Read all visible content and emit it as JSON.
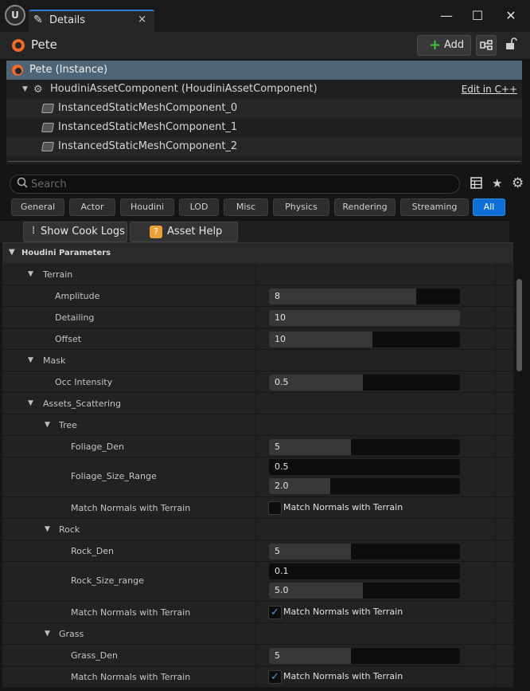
{
  "window": {
    "tab_title": "Details",
    "tab_close": "×",
    "minimize": "—",
    "maximize": "☐",
    "close": "✕"
  },
  "actor": {
    "name": "Pete",
    "add_label": "Add"
  },
  "tree": {
    "root": "Pete (Instance)",
    "component": "HoudiniAssetComponent (HoudiniAssetComponent)",
    "edit_link": "Edit in C++",
    "children": [
      "InstancedStaticMeshComponent_0",
      "InstancedStaticMeshComponent_1",
      "InstancedStaticMeshComponent_2"
    ]
  },
  "search": {
    "placeholder": "Search"
  },
  "categories": [
    "General",
    "Actor",
    "Houdini",
    "LOD",
    "Misc",
    "Physics",
    "Rendering",
    "Streaming",
    "All"
  ],
  "active_category": "All",
  "toolbar": {
    "cook_logs": "Show Cook Logs",
    "asset_help": "Asset Help"
  },
  "section": {
    "title": "Houdini Parameters"
  },
  "params": {
    "terrain": "Terrain",
    "amplitude_label": "Amplitude",
    "amplitude": "8",
    "amplitude_level": 0.77,
    "detailing_label": "Detailing",
    "detailing": "10",
    "detailing_level": 1.0,
    "offset_label": "Offset",
    "offset": "10",
    "offset_level": 0.54,
    "mask": "Mask",
    "occ_label": "Occ Intensity",
    "occ": "0.5",
    "occ_level": 0.49,
    "assets": "Assets_Scattering",
    "tree": "Tree",
    "foliage_den_label": "Foliage_Den",
    "foliage_den": "5",
    "foliage_den_level": 0.43,
    "foliage_size_label": "Foliage_Size_Range",
    "foliage_size_min": "0.5",
    "foliage_size_min_level": 0.0,
    "foliage_size_max": "2.0",
    "foliage_size_max_level": 0.32,
    "tree_match_label": "Match Normals with Terrain",
    "tree_match_check": "Match Normals with Terrain",
    "tree_match": false,
    "rock": "Rock",
    "rock_den_label": "Rock_Den",
    "rock_den": "5",
    "rock_den_level": 0.43,
    "rock_size_label": "Rock_Size_range",
    "rock_size_min": "0.1",
    "rock_size_min_level": 0.0,
    "rock_size_max": "5.0",
    "rock_size_max_level": 0.49,
    "rock_match_label": "Match Normals with Terrain",
    "rock_match_check": "Match Normals with Terrain",
    "rock_match": true,
    "grass": "Grass",
    "grass_den_label": "Grass_Den",
    "grass_den": "5",
    "grass_den_level": 0.43,
    "grass_match_label": "Match Normals with Terrain",
    "grass_match_check": "Match Normals with Terrain",
    "grass_match": true
  },
  "colors": {
    "accent": "#0f6fd6",
    "houdini": "#f06a2a",
    "add_plus": "#3ac43a",
    "selected_row": "#4d6577"
  }
}
